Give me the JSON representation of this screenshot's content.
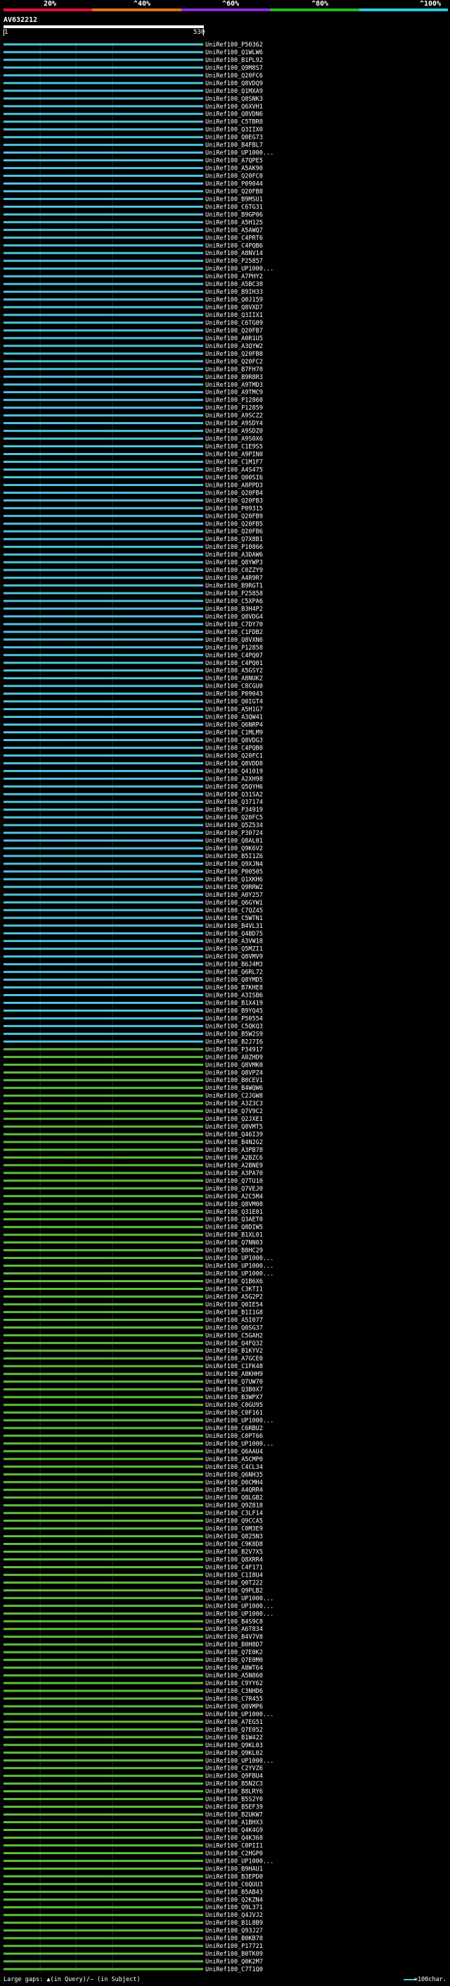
{
  "scale": {
    "labels": [
      "20%",
      "^40%",
      "^60%",
      "^80%",
      "^100%"
    ],
    "colors": [
      "#e0103a",
      "#e0701a",
      "#8a2be2",
      "#22bb22",
      "#2ec8e0"
    ]
  },
  "query": {
    "name": "AV632212",
    "start": "1",
    "end": "530"
  },
  "colors": {
    "high": "#4fc3dd",
    "mid": "#5fbf3f",
    "line": "#000000"
  },
  "hits": [
    "UniRef100_P50362",
    "UniRef100_Q1WLW6",
    "UniRef100_B1PL92",
    "UniRef100_Q9M8S7",
    "UniRef100_Q20FC6",
    "UniRef100_Q8VDQ9",
    "UniRef100_Q1MXA9",
    "UniRef100_Q8SNK3",
    "UniRef100_Q6XVH1",
    "UniRef100_Q8VDN6",
    "UniRef100_C5TBR8",
    "UniRef100_Q3IIX0",
    "UniRef100_Q0EG73",
    "UniRef100_B4FBL7",
    "UniRef100_UP1000...",
    "UniRef100_A7QPE5",
    "UniRef100_A5AK90",
    "UniRef100_Q20FC0",
    "UniRef100_P09044",
    "UniRef100_Q20FB8",
    "UniRef100_B9MSU1",
    "UniRef100_C6TG31",
    "UniRef100_B9GP06",
    "UniRef100_A5H125",
    "UniRef100_A5AWQ7",
    "UniRef100_C4PRT6",
    "UniRef100_C4PQB6",
    "UniRef100_A8NV14",
    "UniRef100_P25857",
    "UniRef100_UP1000...",
    "UniRef100_A7PHY2",
    "UniRef100_A5BC38",
    "UniRef100_B9IH33",
    "UniRef100_Q0J159",
    "UniRef100_Q8VXD7",
    "UniRef100_Q3IIX1",
    "UniRef100_C6TG09",
    "UniRef100_Q20FB7",
    "UniRef100_A0R1U5",
    "UniRef100_A3QYW2",
    "UniRef100_Q20FB8",
    "UniRef100_Q20FC2",
    "UniRef100_B7FH70",
    "UniRef100_B9R8R3",
    "UniRef100_A9TMD3",
    "UniRef100_A9TMC9",
    "UniRef100_P12860",
    "UniRef100_P12859",
    "UniRef100_A9SCZ2",
    "UniRef100_A9SDY4",
    "UniRef100_A9SDZ0",
    "UniRef100_A9S0X6",
    "UniRef100_C1E9S5",
    "UniRef100_A9PIN0",
    "UniRef100_C1M1F7",
    "UniRef100_A4S475",
    "UniRef100_Q00SI6",
    "UniRef100_A8PPD3",
    "UniRef100_Q20FB4",
    "UniRef100_Q20FB3",
    "UniRef100_P09315",
    "UniRef100_Q20FB9",
    "UniRef100_Q20FB5",
    "UniRef100_Q20FB6",
    "UniRef100_Q7X8B1",
    "UniRef100_P10866",
    "UniRef100_A3DAW6",
    "UniRef100_Q8YWP3",
    "UniRef100_C0ZZY9",
    "UniRef100_A4R9R7",
    "UniRef100_B9RGT1",
    "UniRef100_P25858",
    "UniRef100_C5XPA6",
    "UniRef100_B3H4P2",
    "UniRef100_Q8VDG4",
    "UniRef100_C7DY70",
    "UniRef100_C1FDB2",
    "UniRef100_Q8VXN6",
    "UniRef100_P12858",
    "UniRef100_C4PQ07",
    "UniRef100_C4PQ01",
    "UniRef100_A5GSY2",
    "UniRef100_A8NUK2",
    "UniRef100_C8CGU0",
    "UniRef100_P09043",
    "UniRef100_Q0IGT4",
    "UniRef100_A5H1G7",
    "UniRef100_A3QW41",
    "UniRef100_Q6NRP4",
    "UniRef100_C1MLM9",
    "UniRef100_Q8VDG3",
    "UniRef100_C4PQB0",
    "UniRef100_Q20FC1",
    "UniRef100_Q8VDD8",
    "UniRef100_Q41019",
    "UniRef100_A2XH98",
    "UniRef100_Q5QYH6",
    "UniRef100_Q31SA2",
    "UniRef100_Q37174",
    "UniRef100_P34919",
    "UniRef100_Q20FC5",
    "UniRef100_Q5Z534",
    "UniRef100_P30724",
    "UniRef100_Q8AL01",
    "UniRef100_Q9K6V2",
    "UniRef100_B5I1Z6",
    "UniRef100_Q9XJN4",
    "UniRef100_P00505",
    "UniRef100_Q1XKH6",
    "UniRef100_Q9RRW2",
    "UniRef100_A0Y257",
    "UniRef100_Q6GYW1",
    "UniRef100_C7QZ45",
    "UniRef100_C5WTN1",
    "UniRef100_B4VL31",
    "UniRef100_Q4BD75",
    "UniRef100_A3VW18",
    "UniRef100_Q5MZI1",
    "UniRef100_Q8VMV9",
    "UniRef100_B6J4M3",
    "UniRef100_Q6RL72",
    "UniRef100_Q8YMD5",
    "UniRef100_B7KHE8",
    "UniRef100_A3ISB6",
    "UniRef100_B1X419",
    "UniRef100_B9YQ45",
    "UniRef100_P50554",
    "UniRef100_C5QKQ3",
    "UniRef100_B5W2S9",
    "UniRef100_B2J7I6",
    "UniRef100_P34917",
    "UniRef100_A0ZHD9",
    "UniRef100_Q8VMK0",
    "UniRef100_Q8VPZ4",
    "UniRef100_B0CEV1",
    "UniRef100_B4WQW6",
    "UniRef100_C2JGW8",
    "UniRef100_A3Z3C3",
    "UniRef100_Q7V9C2",
    "UniRef100_Q2JXE1",
    "UniRef100_Q8VMT5",
    "UniRef100_Q46I39",
    "UniRef100_B4N2G2",
    "UniRef100_A3PB78",
    "UniRef100_A2BZC6",
    "UniRef100_A2BNE9",
    "UniRef100_A3PA70",
    "UniRef100_Q7TU10",
    "UniRef100_Q7VEJ0",
    "UniRef100_A2C5M4",
    "UniRef100_Q8VM08",
    "UniRef100_Q31E01",
    "UniRef100_Q3AET0",
    "UniRef100_Q8DIW5",
    "UniRef100_B1XL01",
    "UniRef100_Q7NN03",
    "UniRef100_B8HC29",
    "UniRef100_UP1000...",
    "UniRef100_UP1000...",
    "UniRef100_UP1000...",
    "UniRef100_Q1B6X6",
    "UniRef100_C3KTI1",
    "UniRef100_A5G2P2",
    "UniRef100_Q0IE54",
    "UniRef100_B1I1G8",
    "UniRef100_A5I077",
    "UniRef100_Q0SG37",
    "UniRef100_C5GAH2",
    "UniRef100_Q4FQ32",
    "UniRef100_B1KYV2",
    "UniRef100_A7GCE0",
    "UniRef100_C1FK48",
    "UniRef100_A8KHH9",
    "UniRef100_Q7UW70",
    "UniRef100_Q3B0X7",
    "UniRef100_B3WPX7",
    "UniRef100_C0GU95",
    "UniRef100_C0F161",
    "UniRef100_UP1000...",
    "UniRef100_C6RBU2",
    "UniRef100_C0PT66",
    "UniRef100_UP1000...",
    "UniRef100_Q6AAU4",
    "UniRef100_A5CMP0",
    "UniRef100_C4CL34",
    "UniRef100_Q6NH35",
    "UniRef100_D0CMH4",
    "UniRef100_A4QRR4",
    "UniRef100_Q8LGB2",
    "UniRef100_Q9Z818",
    "UniRef100_C3LF14",
    "UniRef100_Q9CCA5",
    "UniRef100_C0M3E9",
    "UniRef100_Q825N3",
    "UniRef100_C9K8D8",
    "UniRef100_B2V7X5",
    "UniRef100_Q8XRR4",
    "UniRef100_C4F171",
    "UniRef100_C1I8U4",
    "UniRef100_Q0T222",
    "UniRef100_Q9PLB2",
    "UniRef100_UP1000...",
    "UniRef100_UP1000...",
    "UniRef100_UP1000...",
    "UniRef100_B4S9C8",
    "UniRef100_A6T834",
    "UniRef100_B4V7V8",
    "UniRef100_B0H8D7",
    "UniRef100_Q7E0K2",
    "UniRef100_Q7E0M0",
    "UniRef100_A8WT64",
    "UniRef100_A5N860",
    "UniRef100_C9YY62",
    "UniRef100_C3NHD6",
    "UniRef100_C7R455",
    "UniRef100_Q8VMP6",
    "UniRef100_UP1000...",
    "UniRef100_A7EG51",
    "UniRef100_Q7E052",
    "UniRef100_B1W422",
    "UniRef100_Q9KL03",
    "UniRef100_Q9KL02",
    "UniRef100_UP1000...",
    "UniRef100_C2YVZ6",
    "UniRef100_Q9FBU4",
    "UniRef100_B5N2C3",
    "UniRef100_B8LRY6",
    "UniRef100_B5S2Y0",
    "UniRef100_B5EF39",
    "UniRef100_B2UKW7",
    "UniRef100_A1BHX3",
    "UniRef100_Q4K4G9",
    "UniRef100_Q4K368",
    "UniRef100_C0PII1",
    "UniRef100_C2HGP0",
    "UniRef100_UP1000...",
    "UniRef100_B9HAU1",
    "UniRef100_B3EPD0",
    "UniRef100_C6QUU3",
    "UniRef100_B5AB43",
    "UniRef100_Q2KZN4",
    "UniRef100_Q9L371",
    "UniRef100_Q4JVJ2",
    "UniRef100_B1L8B9",
    "UniRef100_Q93J27",
    "UniRef100_B0KB78",
    "UniRef100_P17721",
    "UniRef100_B0TK09",
    "UniRef100_Q0K2M7",
    "UniRef100_C7T1Q0"
  ],
  "legend": {
    "left": "Large gaps: ▲(in Query)/— (in Subject)",
    "right": "=100char."
  }
}
